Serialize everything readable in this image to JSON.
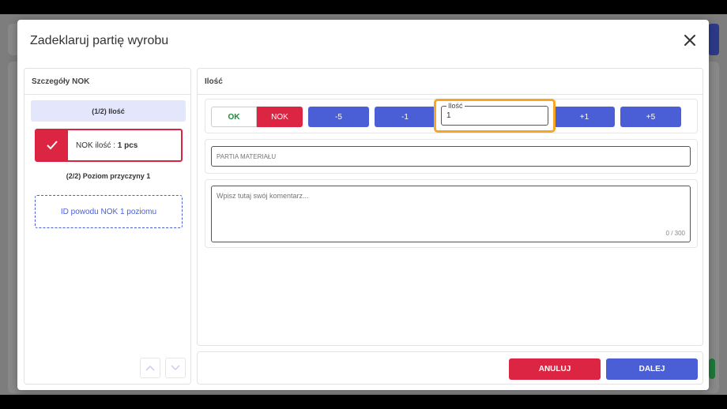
{
  "modal": {
    "title": "Zadeklaruj partię wyrobu"
  },
  "left_panel": {
    "header": "Szczegóły NOK",
    "step1_label": "(1/2) Ilość",
    "nok_prefix": "NOK ilość : ",
    "nok_value": "1 pcs",
    "step2_label": "(2/2) Poziom przyczyny 1",
    "reason_placeholder": "ID powodu NOK 1 poziomu"
  },
  "right_panel": {
    "header": "Ilość",
    "ok_label": "OK",
    "nok_label": "NOK",
    "minus5": "-5",
    "minus1": "-1",
    "plus1": "+1",
    "plus5": "+5",
    "qty_label": "Ilość",
    "qty_value": "1",
    "batch_placeholder": "PARTIA MATERIAŁU",
    "comment_placeholder": "Wpisz tutaj swój komentarz...",
    "counter": "0 / 300"
  },
  "footer": {
    "cancel_label": "ANULUJ",
    "next_label": "DALEJ"
  },
  "colors": {
    "primary": "#4a5fd6",
    "danger": "#dc2543",
    "highlight": "#f5a623",
    "ok_text": "#1a8a3a"
  }
}
